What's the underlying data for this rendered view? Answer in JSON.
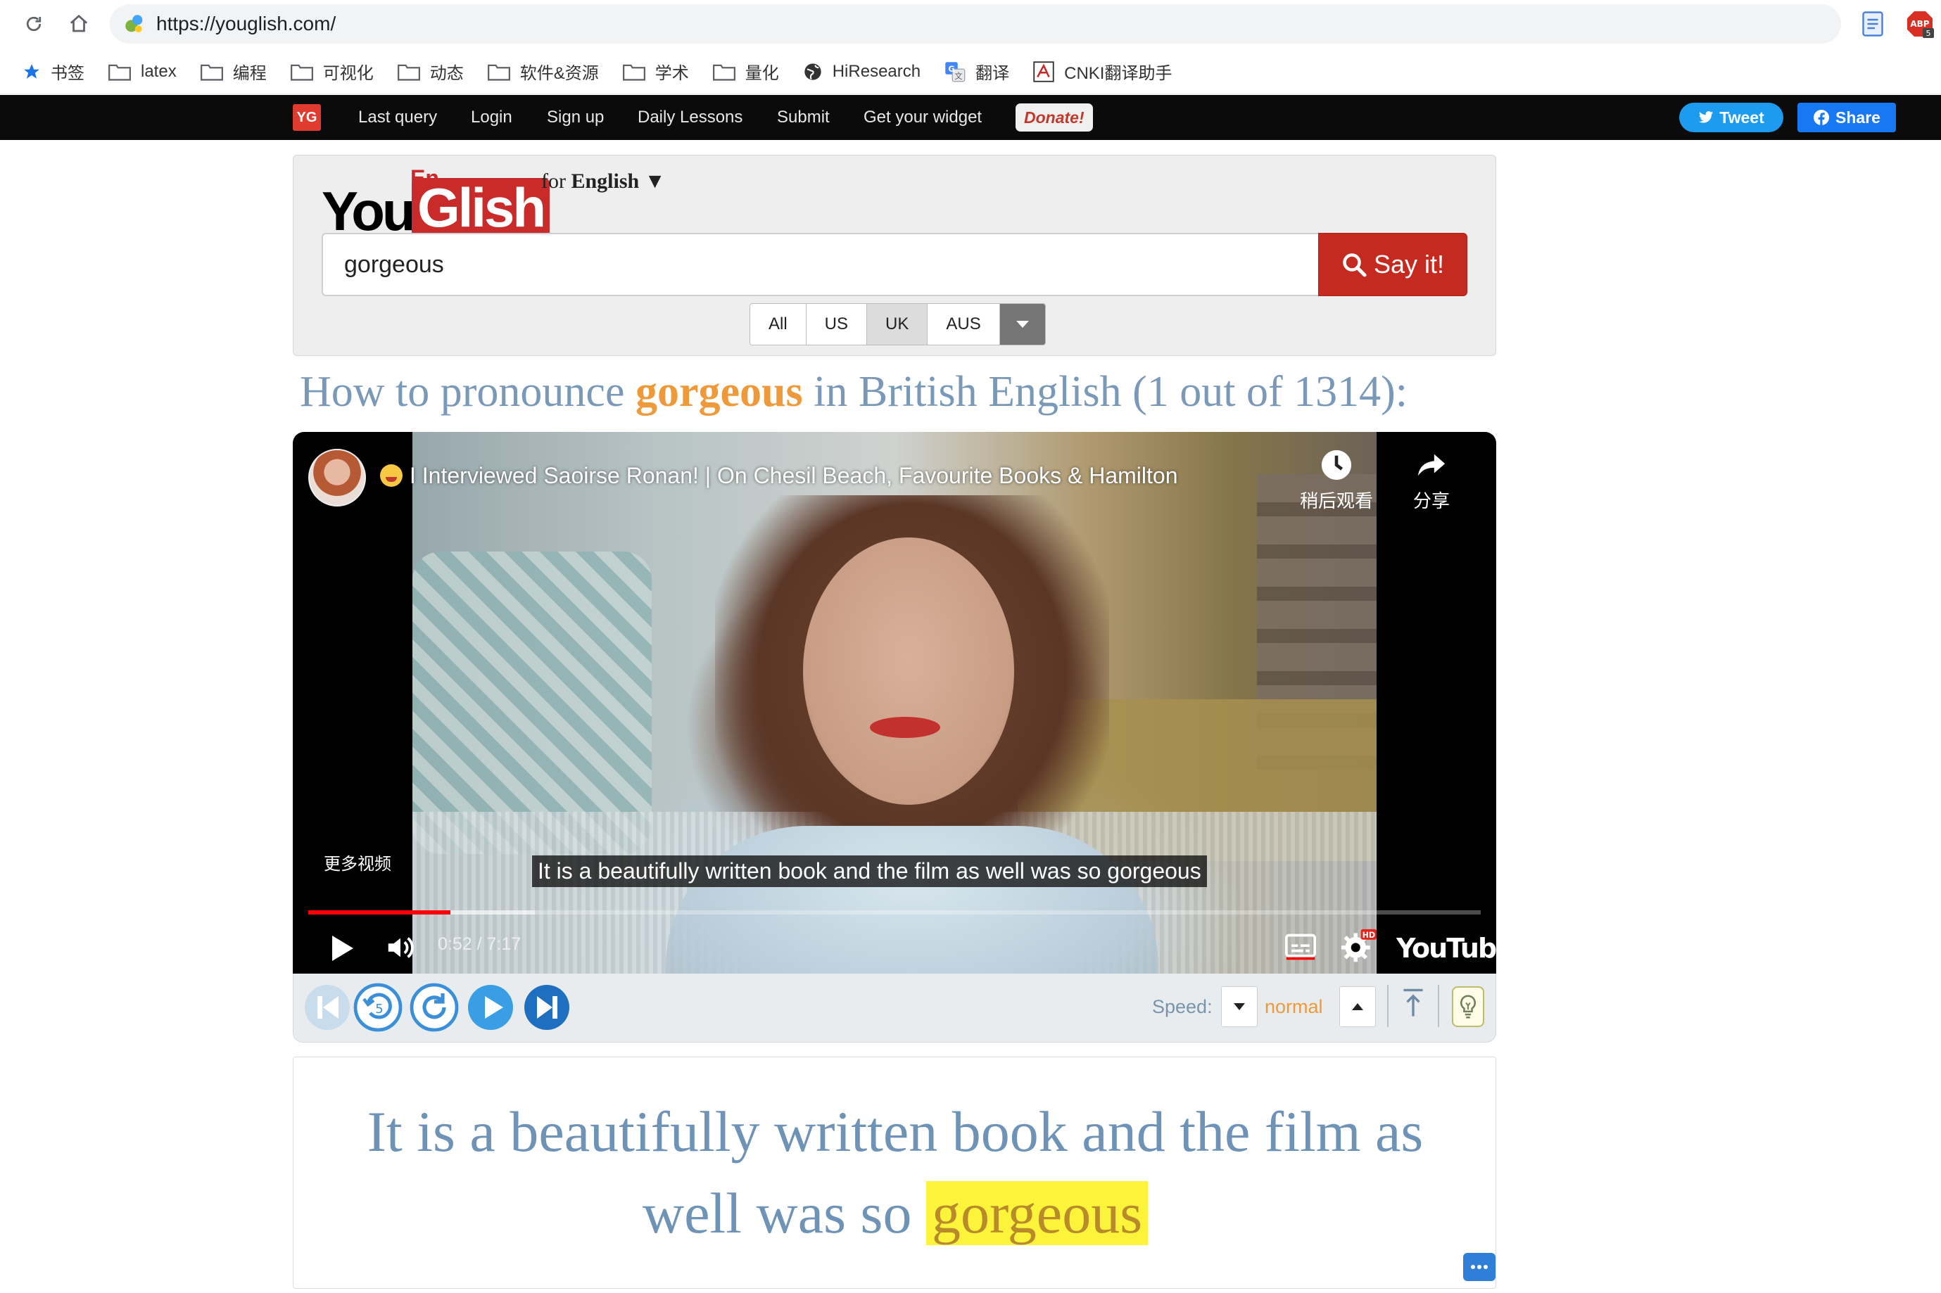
{
  "browser": {
    "url": "https://youglish.com/",
    "bookmarks": [
      {
        "label": "书签",
        "icon": "star-icon"
      },
      {
        "label": "latex",
        "icon": "folder-icon"
      },
      {
        "label": "编程",
        "icon": "folder-icon"
      },
      {
        "label": "可视化",
        "icon": "folder-icon"
      },
      {
        "label": "动态",
        "icon": "folder-icon"
      },
      {
        "label": "软件&资源",
        "icon": "folder-icon"
      },
      {
        "label": "学术",
        "icon": "folder-icon"
      },
      {
        "label": "量化",
        "icon": "folder-icon"
      },
      {
        "label": "HiResearch",
        "icon": "globe-icon"
      },
      {
        "label": "翻译",
        "icon": "translate-icon"
      },
      {
        "label": "CNKI翻译助手",
        "icon": "cnki-icon"
      }
    ],
    "abp_badge": "5",
    "abp_label": "ABP"
  },
  "topnav": {
    "badge": "YG",
    "items": [
      "Last query",
      "Login",
      "Sign up",
      "Daily Lessons",
      "Submit",
      "Get your widget"
    ],
    "donate": "Donate!",
    "tweet": "Tweet",
    "share": "Share"
  },
  "search": {
    "logo_you": "You",
    "logo_glish": "Glish",
    "logo_en": "En",
    "lang_prefix": "for",
    "lang": "English",
    "lang_caret": "▼",
    "query": "gorgeous",
    "button": "Say it!",
    "accents": [
      "All",
      "US",
      "UK",
      "AUS"
    ],
    "active_accent": "UK"
  },
  "heading": {
    "before": "How to pronounce ",
    "keyword": "gorgeous",
    "after": " in British English (1 out of 1314):"
  },
  "video": {
    "title": "I Interviewed Saoirse Ronan! | On Chesil Beach, Favourite Books & Hamilton",
    "watch_later": "稍后观看",
    "share": "分享",
    "more_videos": "更多视频",
    "caption": "It is a beautifully written book and the film as well was so gorgeous",
    "time": "0:52 / 7:17",
    "progress_played": 0.121,
    "progress_buffered": 0.193,
    "youtube": "YouTube",
    "hd_badge": "HD"
  },
  "controls": {
    "speed_label": "Speed:",
    "speed_value": "normal",
    "replay_seconds": "5"
  },
  "transcript": {
    "before": "It is a beautifully written book and the film as well was so ",
    "highlight": "gorgeous",
    "more_icon": "more-dots-icon"
  },
  "colors": {
    "brand_red": "#c52a20",
    "keyword_orange": "#ef9a3a",
    "heading_blue": "#7a99b8",
    "highlight_yellow": "#fbf43a",
    "tweet_blue": "#1d9bf0",
    "facebook_blue": "#1877f2"
  }
}
